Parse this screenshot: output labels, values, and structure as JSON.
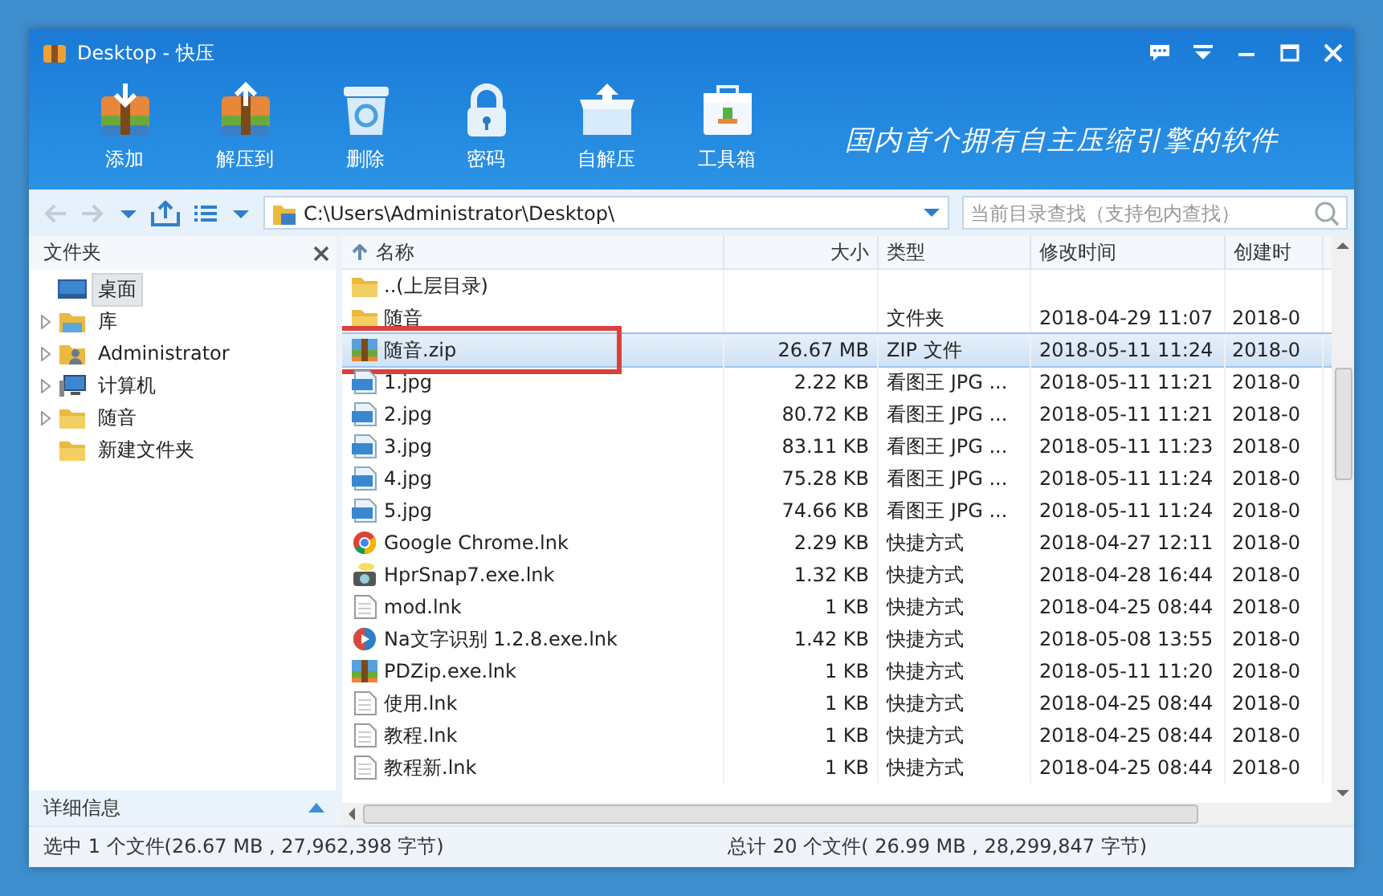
{
  "window": {
    "title": "Desktop - 快压"
  },
  "toolbar": [
    {
      "label": "添加",
      "kind": "add"
    },
    {
      "label": "解压到",
      "kind": "extract"
    },
    {
      "label": "删除",
      "kind": "delete"
    },
    {
      "label": "密码",
      "kind": "password"
    },
    {
      "label": "自解压",
      "kind": "sfx"
    },
    {
      "label": "工具箱",
      "kind": "toolbox"
    }
  ],
  "slogan": "国内首个拥有自主压缩引擎的软件",
  "nav": {
    "back_disabled": true,
    "forward_disabled": true
  },
  "address": {
    "value": "C:\\Users\\Administrator\\Desktop\\"
  },
  "search": {
    "placeholder": "当前目录查找（支持包内查找）"
  },
  "folder_panel": {
    "title": "文件夹",
    "items": [
      {
        "label": "桌面",
        "kind": "desktop",
        "selected": true
      },
      {
        "label": "库",
        "kind": "library",
        "selected": false,
        "expanded": false
      },
      {
        "label": "Administrator",
        "kind": "user",
        "selected": false,
        "expanded": false
      },
      {
        "label": "计算机",
        "kind": "computer",
        "selected": false,
        "expanded": false
      },
      {
        "label": "随音",
        "kind": "folder",
        "selected": false,
        "expanded": false
      },
      {
        "label": "新建文件夹",
        "kind": "folder",
        "selected": false
      }
    ]
  },
  "details_panel": {
    "label": "详细信息"
  },
  "table": {
    "columns": [
      {
        "label": "名称",
        "kind": "name",
        "sorted": true
      },
      {
        "label": "大小",
        "kind": "size",
        "sorted": false
      },
      {
        "label": "类型",
        "kind": "type",
        "sorted": false
      },
      {
        "label": "修改时间",
        "kind": "modified",
        "sorted": false
      },
      {
        "label": "创建时",
        "kind": "created",
        "sorted": false
      }
    ],
    "rows": [
      {
        "name": "..(上层目录)",
        "kind": "folder",
        "selected": false,
        "annotated": false
      },
      {
        "name": "随音",
        "kind": "folder",
        "type": "文件夹",
        "modified": "2018-04-29 11:07",
        "created": "2018-0",
        "selected": false,
        "annotated": false
      },
      {
        "name": "随音.zip",
        "kind": "zip",
        "size": "26.67 MB",
        "type": "ZIP 文件",
        "modified": "2018-05-11 11:24",
        "created": "2018-0",
        "selected": true,
        "annotated": true
      },
      {
        "name": "1.jpg",
        "kind": "jpg",
        "size": "2.22 KB",
        "type": "看图王 JPG ...",
        "modified": "2018-05-11 11:21",
        "created": "2018-0",
        "selected": false,
        "annotated": false
      },
      {
        "name": "2.jpg",
        "kind": "jpg",
        "size": "80.72 KB",
        "type": "看图王 JPG ...",
        "modified": "2018-05-11 11:21",
        "created": "2018-0",
        "selected": false,
        "annotated": false
      },
      {
        "name": "3.jpg",
        "kind": "jpg",
        "size": "83.11 KB",
        "type": "看图王 JPG ...",
        "modified": "2018-05-11 11:23",
        "created": "2018-0",
        "selected": false,
        "annotated": false
      },
      {
        "name": "4.jpg",
        "kind": "jpg",
        "size": "75.28 KB",
        "type": "看图王 JPG ...",
        "modified": "2018-05-11 11:24",
        "created": "2018-0",
        "selected": false,
        "annotated": false
      },
      {
        "name": "5.jpg",
        "kind": "jpg",
        "size": "74.66 KB",
        "type": "看图王 JPG ...",
        "modified": "2018-05-11 11:24",
        "created": "2018-0",
        "selected": false,
        "annotated": false
      },
      {
        "name": "Google Chrome.lnk",
        "kind": "chrome",
        "size": "2.29 KB",
        "type": "快捷方式",
        "modified": "2018-04-27 12:11",
        "created": "2018-0",
        "selected": false,
        "annotated": false
      },
      {
        "name": "HprSnap7.exe.lnk",
        "kind": "camera",
        "size": "1.32 KB",
        "type": "快捷方式",
        "modified": "2018-04-28 16:44",
        "created": "2018-0",
        "selected": false,
        "annotated": false
      },
      {
        "name": "mod.lnk",
        "kind": "doc",
        "size": "1 KB",
        "type": "快捷方式",
        "modified": "2018-04-25 08:44",
        "created": "2018-0",
        "selected": false,
        "annotated": false
      },
      {
        "name": "Na文字识别 1.2.8.exe.lnk",
        "kind": "play",
        "size": "1.42 KB",
        "type": "快捷方式",
        "modified": "2018-05-08 13:55",
        "created": "2018-0",
        "selected": false,
        "annotated": false
      },
      {
        "name": "PDZip.exe.lnk",
        "kind": "zip",
        "size": "1 KB",
        "type": "快捷方式",
        "modified": "2018-05-11 11:20",
        "created": "2018-0",
        "selected": false,
        "annotated": false
      },
      {
        "name": "使用.lnk",
        "kind": "doc",
        "size": "1 KB",
        "type": "快捷方式",
        "modified": "2018-04-25 08:44",
        "created": "2018-0",
        "selected": false,
        "annotated": false
      },
      {
        "name": "教程.lnk",
        "kind": "doc",
        "size": "1 KB",
        "type": "快捷方式",
        "modified": "2018-04-25 08:44",
        "created": "2018-0",
        "selected": false,
        "annotated": false
      },
      {
        "name": "教程新.lnk",
        "kind": "doc",
        "size": "1 KB",
        "type": "快捷方式",
        "modified": "2018-04-25 08:44",
        "created": "2018-0",
        "selected": false,
        "annotated": false
      }
    ]
  },
  "status_bar": {
    "selection": "选中 1 个文件(26.67 MB , 27,962,398 字节)",
    "total": "总计 20 个文件( 26.99 MB , 28,299,847 字节)"
  }
}
